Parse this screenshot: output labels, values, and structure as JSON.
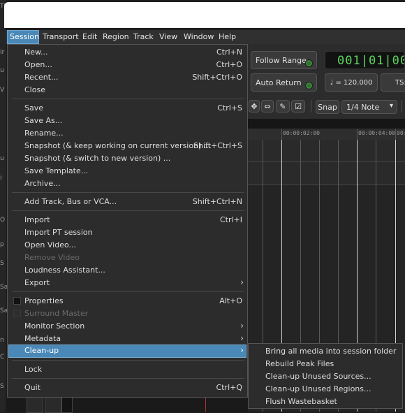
{
  "window": {
    "edge_glyphs": [
      "Ti",
      "ir",
      "u",
      "V",
      "u",
      "i",
      "O",
      "p",
      "S",
      "Sa",
      "Sa",
      "n",
      "C",
      "S"
    ]
  },
  "menubar": {
    "items": [
      {
        "label": "Session",
        "active": true
      },
      {
        "label": "Transport"
      },
      {
        "label": "Edit"
      },
      {
        "label": "Region"
      },
      {
        "label": "Track"
      },
      {
        "label": "View"
      },
      {
        "label": "Window"
      },
      {
        "label": "Help"
      }
    ]
  },
  "toolbar": {
    "follow_range": "Follow Range",
    "auto_return": "Auto Return",
    "clock": "001|01|00",
    "tempo": "♩ = 120.000",
    "ts": "TS:",
    "snap": "Snap",
    "grid": "1/4 Note",
    "grid_arrow": "▾"
  },
  "ruler": {
    "labels": [
      "00:00:02:00",
      "00:00:04:00",
      "00:"
    ]
  },
  "session_menu": {
    "items": [
      {
        "label": "New...",
        "shortcut": "Ctrl+N"
      },
      {
        "label": "Open...",
        "shortcut": "Ctrl+O"
      },
      {
        "label": "Recent...",
        "shortcut": "Shift+Ctrl+O"
      },
      {
        "label": "Close",
        "shortcut": ""
      },
      {
        "label": "Save",
        "shortcut": "Ctrl+S"
      },
      {
        "label": "Save As...",
        "shortcut": ""
      },
      {
        "label": "Rename...",
        "shortcut": ""
      },
      {
        "label": "Snapshot (& keep working on current version) ...",
        "shortcut": "Shift+Ctrl+S"
      },
      {
        "label": "Snapshot (& switch to new version) ...",
        "shortcut": ""
      },
      {
        "label": "Save Template...",
        "shortcut": ""
      },
      {
        "label": "Archive...",
        "shortcut": ""
      },
      {
        "label": "Add Track, Bus or VCA...",
        "shortcut": "Shift+Ctrl+N"
      },
      {
        "label": "Import",
        "shortcut": "Ctrl+I"
      },
      {
        "label": "Import PT session",
        "shortcut": ""
      },
      {
        "label": "Open Video...",
        "shortcut": ""
      },
      {
        "label": "Remove Video",
        "shortcut": "",
        "disabled": true
      },
      {
        "label": "Loudness Assistant...",
        "shortcut": ""
      },
      {
        "label": "Export",
        "submenu": true
      },
      {
        "label": "Properties",
        "shortcut": "Alt+O",
        "checkbox": true
      },
      {
        "label": "Surround Master",
        "shortcut": "",
        "checkbox": true,
        "disabled": true
      },
      {
        "label": "Monitor Section",
        "submenu": true
      },
      {
        "label": "Metadata",
        "submenu": true
      },
      {
        "label": "Clean-up",
        "submenu": true,
        "highlighted": true
      },
      {
        "label": "Lock",
        "shortcut": ""
      },
      {
        "label": "Quit",
        "shortcut": "Ctrl+Q"
      }
    ],
    "submenu_arrow": "›"
  },
  "cleanup_submenu": {
    "items": [
      {
        "label": "Bring all media into session folder"
      },
      {
        "label": "Rebuild Peak Files"
      },
      {
        "label": "Clean-up Unused Sources..."
      },
      {
        "label": "Clean-up Unused Regions..."
      },
      {
        "label": "Flush Wastebasket"
      }
    ]
  }
}
